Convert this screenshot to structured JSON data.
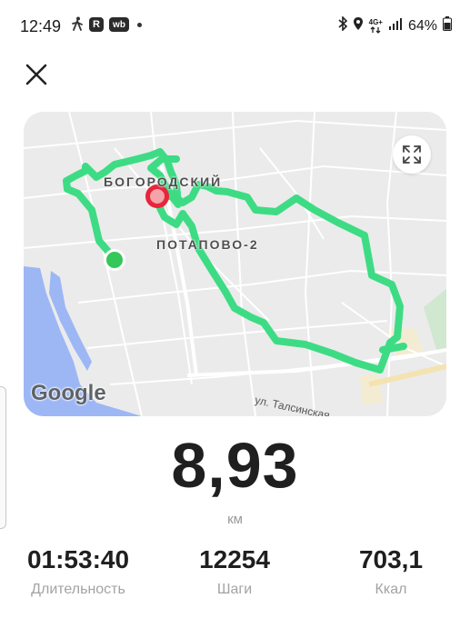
{
  "status_bar": {
    "time": "12:49",
    "battery": "64%",
    "network_top": "4G+",
    "badge_r": "R",
    "badge_wb": "wb"
  },
  "map": {
    "labels": {
      "district1": "БОГОРОДСКИЙ",
      "district2": "ПОТАПОВО-2",
      "street": "ул. Талсинская"
    },
    "attribution": "Google",
    "route_color": "#3ddc84",
    "start_color": "#34c759",
    "end_color": "#e8253a"
  },
  "summary": {
    "distance": "8,93",
    "distance_unit": "км"
  },
  "stats": [
    {
      "value": "01:53:40",
      "label": "Длительность"
    },
    {
      "value": "12254",
      "label": "Шаги"
    },
    {
      "value": "703,1",
      "label": "Ккал"
    }
  ]
}
